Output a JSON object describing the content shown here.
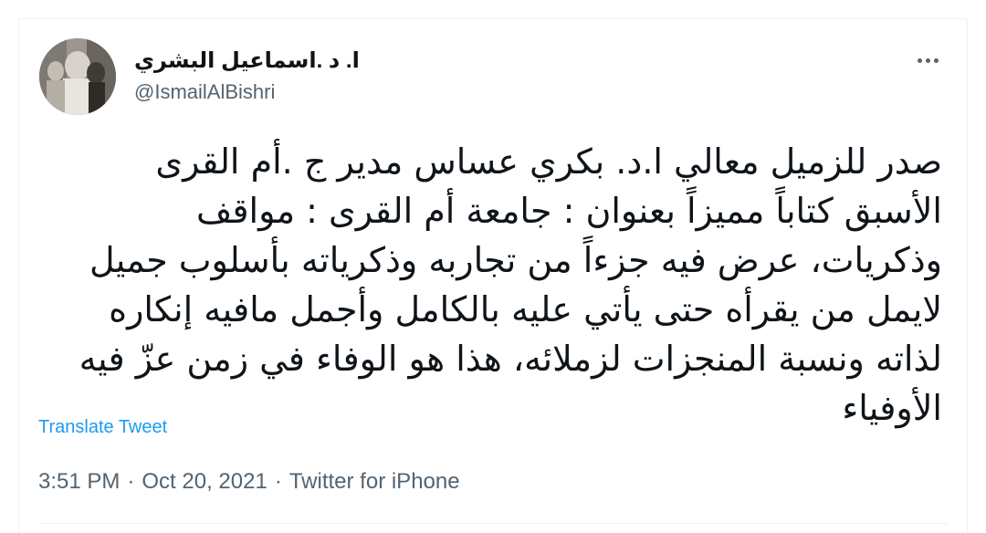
{
  "author": {
    "display_name": "ا. د .اسماعيل البشري",
    "handle": "@IsmailAlBishri"
  },
  "tweet": {
    "text": "صدر للزميل معالي ا.د. بكري عساس مدير ج .أم القرى\nالأسبق كتاباً مميزاً بعنوان : جامعة أم القرى : مواقف\nوذكريات، عرض فيه جزءاً من تجاربه وذكرياته بأسلوب جميل\nلايمل من يقرأه حتى يأتي عليه بالكامل وأجمل مافيه إنكاره\nلذاته ونسبة المنجزات لزملائه، هذا هو الوفاء في زمن عزّ فيه\nالأوفياء"
  },
  "actions": {
    "translate_label": "Translate Tweet",
    "more_icon": "more-horizontal-icon"
  },
  "meta": {
    "time": "3:51 PM",
    "separator": "·",
    "date": "Oct 20, 2021",
    "source": "Twitter for iPhone"
  },
  "colors": {
    "text_primary": "#0f1419",
    "text_secondary": "#536471",
    "link": "#1d9bf0",
    "border": "#eff3f4"
  }
}
